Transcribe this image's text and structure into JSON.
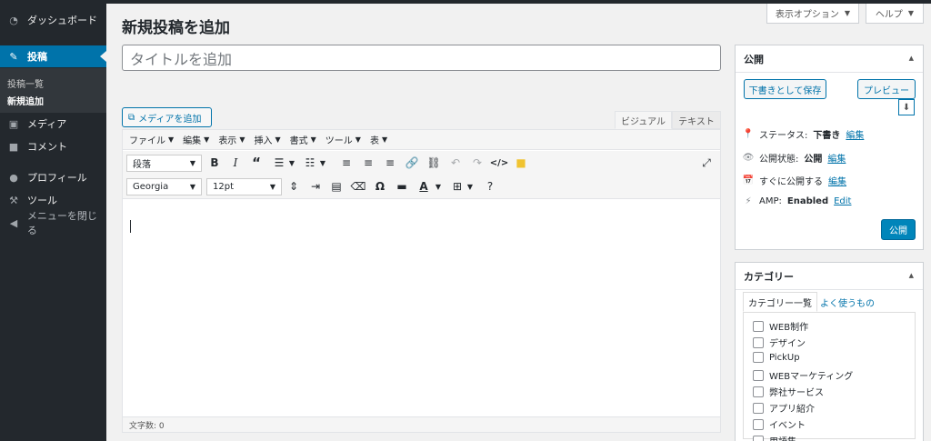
{
  "sidebar": {
    "items": [
      {
        "label": "ダッシュボード",
        "icon": "dashboard-icon"
      },
      {
        "label": "投稿",
        "icon": "pin-icon"
      },
      {
        "label": "メディア",
        "icon": "media-icon"
      },
      {
        "label": "コメント",
        "icon": "comment-icon"
      },
      {
        "label": "プロフィール",
        "icon": "user-icon"
      },
      {
        "label": "ツール",
        "icon": "wrench-icon"
      },
      {
        "label": "メニューを閉じる",
        "icon": "collapse-icon"
      }
    ],
    "submenu": [
      "投稿一覧",
      "新規追加"
    ]
  },
  "screen_meta": {
    "options": "表示オプション",
    "help": "ヘルプ"
  },
  "page": {
    "title": "新規投稿を追加",
    "title_placeholder": "タイトルを追加"
  },
  "editor": {
    "add_media": "メディアを追加",
    "tabs": {
      "visual": "ビジュアル",
      "text": "テキスト"
    },
    "menubar": [
      "ファイル",
      "編集",
      "表示",
      "挿入",
      "書式",
      "ツール",
      "表"
    ],
    "format_select": "段落",
    "font_select": "Georgia",
    "size_select": "12pt",
    "word_count": "文字数: 0"
  },
  "publish_box": {
    "title": "公開",
    "save_draft": "下書きとして保存",
    "preview": "プレビュー",
    "status_label": "ステータス:",
    "status_value": "下書き",
    "visibility_label": "公開状態:",
    "visibility_value": "公開",
    "schedule_label": "すぐに公開する",
    "amp_label": "AMP:",
    "amp_value": "Enabled",
    "edit": "編集",
    "edit_en": "Edit",
    "publish": "公開"
  },
  "category_box": {
    "title": "カテゴリー",
    "tab_all": "カテゴリー一覧",
    "tab_popular": "よく使うもの",
    "items": [
      "WEB制作",
      "デザイン",
      "PickUp",
      "WEBマーケティング",
      "弊社サービス",
      "アプリ紹介",
      "イベント",
      "用語集"
    ]
  },
  "colors": {
    "sidebar": "#23282d",
    "accent": "#0073aa",
    "publish": "#0085ba"
  }
}
